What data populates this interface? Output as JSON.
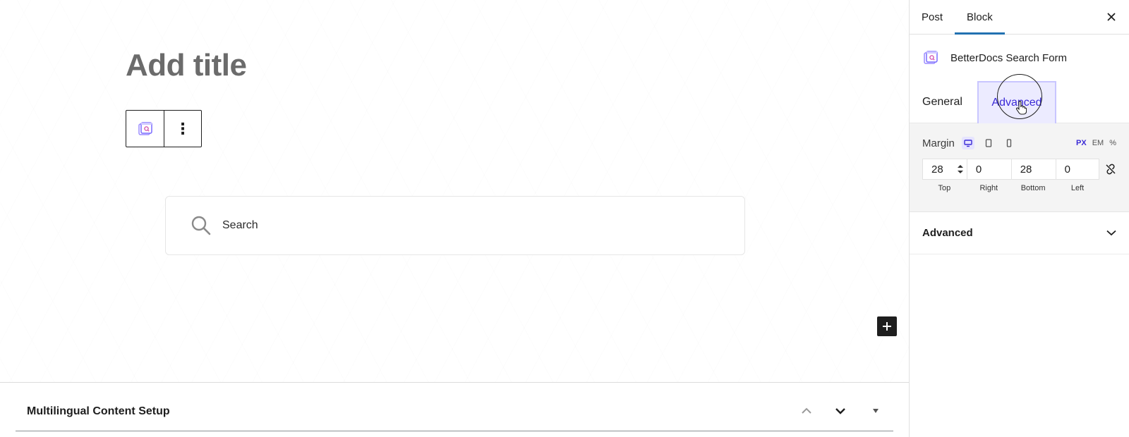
{
  "editor": {
    "title_placeholder": "Add title",
    "toolbar": {
      "more_label": "⋮"
    },
    "search": {
      "text": "Search"
    }
  },
  "meta_panel": {
    "title": "Multilingual Content Setup"
  },
  "sidebar": {
    "tabs": [
      {
        "label": "Post"
      },
      {
        "label": "Block",
        "active": true
      }
    ],
    "block_name": "BetterDocs Search Form",
    "sub_tabs": {
      "general": "General",
      "advanced": "Advanced",
      "active": "advanced"
    },
    "margin": {
      "label": "Margin",
      "units": [
        "PX",
        "EM",
        "%"
      ],
      "active_unit": "PX",
      "active_device": "desktop",
      "fields": [
        {
          "label": "Top",
          "value": "28"
        },
        {
          "label": "Right",
          "value": "0"
        },
        {
          "label": "Bottom",
          "value": "28"
        },
        {
          "label": "Left",
          "value": "0"
        }
      ]
    },
    "advanced_section": {
      "label": "Advanced",
      "expanded": false
    }
  },
  "colors": {
    "accent": "#3b2bd6",
    "tab_indicator": "#2271b1",
    "dark": "#1e1e1e"
  },
  "icons": [
    "block-icon",
    "search-icon",
    "plus-icon",
    "close-icon",
    "desktop-icon",
    "tablet-icon",
    "mobile-icon",
    "unlink-icon",
    "chevron-down-icon",
    "chevron-up-icon",
    "caret-down-icon",
    "hand-cursor-icon"
  ]
}
